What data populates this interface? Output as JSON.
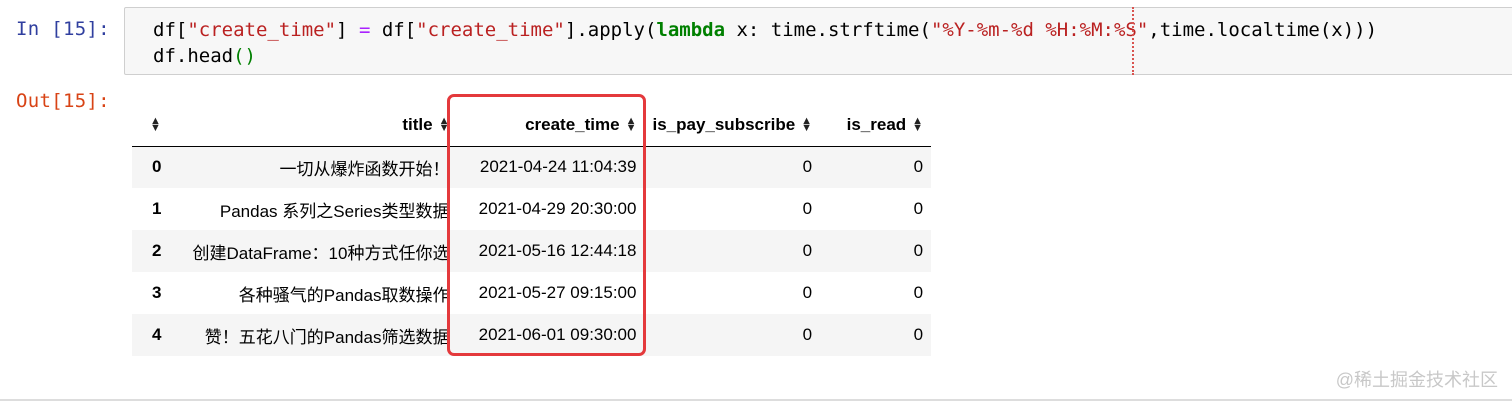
{
  "cell": {
    "in_prompt": "In [15]:",
    "out_prompt": "Out[15]:",
    "code": {
      "l1_a": "df[",
      "l1_s1": "\"create_time\"",
      "l1_b": "] ",
      "l1_eq": "=",
      "l1_c": " df[",
      "l1_s2": "\"create_time\"",
      "l1_d": "].apply(",
      "l1_kw": "lambda",
      "l1_e": " x: time.strftime(",
      "l1_s3": "\"%Y-%m-%d %H:%M:%S\"",
      "l1_f": ",time.localtime(x)))",
      "l2_a": "df.head",
      "l2_p": "()"
    }
  },
  "table": {
    "columns": [
      "title",
      "create_time",
      "is_pay_subscribe",
      "is_read"
    ],
    "rows": [
      {
        "index": "0",
        "title": "一切从爆炸函数开始！",
        "create_time": "2021-04-24 11:04:39",
        "is_pay_subscribe": "0",
        "is_read": "0"
      },
      {
        "index": "1",
        "title": "Pandas 系列之Series类型数据",
        "create_time": "2021-04-29 20:30:00",
        "is_pay_subscribe": "0",
        "is_read": "0"
      },
      {
        "index": "2",
        "title": "创建DataFrame：10种方式任你选",
        "create_time": "2021-05-16 12:44:18",
        "is_pay_subscribe": "0",
        "is_read": "0"
      },
      {
        "index": "3",
        "title": "各种骚气的Pandas取数操作",
        "create_time": "2021-05-27 09:15:00",
        "is_pay_subscribe": "0",
        "is_read": "0"
      },
      {
        "index": "4",
        "title": "赞！五花八门的Pandas筛选数据",
        "create_time": "2021-06-01 09:30:00",
        "is_pay_subscribe": "0",
        "is_read": "0"
      }
    ]
  },
  "sort_icon": "sort-arrows-icon",
  "highlight_color": "#e4393c",
  "watermark": "@稀土掘金技术社区"
}
